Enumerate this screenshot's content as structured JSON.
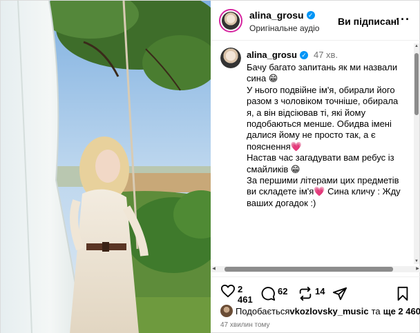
{
  "post": {
    "username": "alina_grosu",
    "audio": "Оригінальне аудіо",
    "follow_label": "Ви підписані",
    "more_label": "···"
  },
  "caption": {
    "username": "alina_grosu",
    "time": "47 хв.",
    "lines": [
      "Бачу багато запитань як ми назвали сина 😁",
      "У нього подвійне ім'я, обирали його разом з чоловіком точніше, обирала я, а він відсіював ті, які йому подобаються менше. Обидва імені далися йому не просто так, а є пояснення💗",
      "Настав час загадувати вам ребус із смайликів 😁",
      "За першими літерами цих предметів ви складете ім'я💗 Сина кличу : Жду ваших догадок :)"
    ]
  },
  "actions": {
    "like_count": "2 461",
    "comment_count": "62",
    "repost_count": "14"
  },
  "likes": {
    "prefix": "Подобається",
    "user": "vkozlovsky_music",
    "middle": "та",
    "others": "ще 2 460"
  },
  "timestamp": "47 хвилин тому",
  "icons": [
    "verified-icon",
    "heart-icon",
    "comment-icon",
    "repost-icon",
    "share-icon",
    "bookmark-icon"
  ],
  "colors": {
    "verified": "#0095f6",
    "story_ring": "#d6249f",
    "muted": "#737373"
  }
}
